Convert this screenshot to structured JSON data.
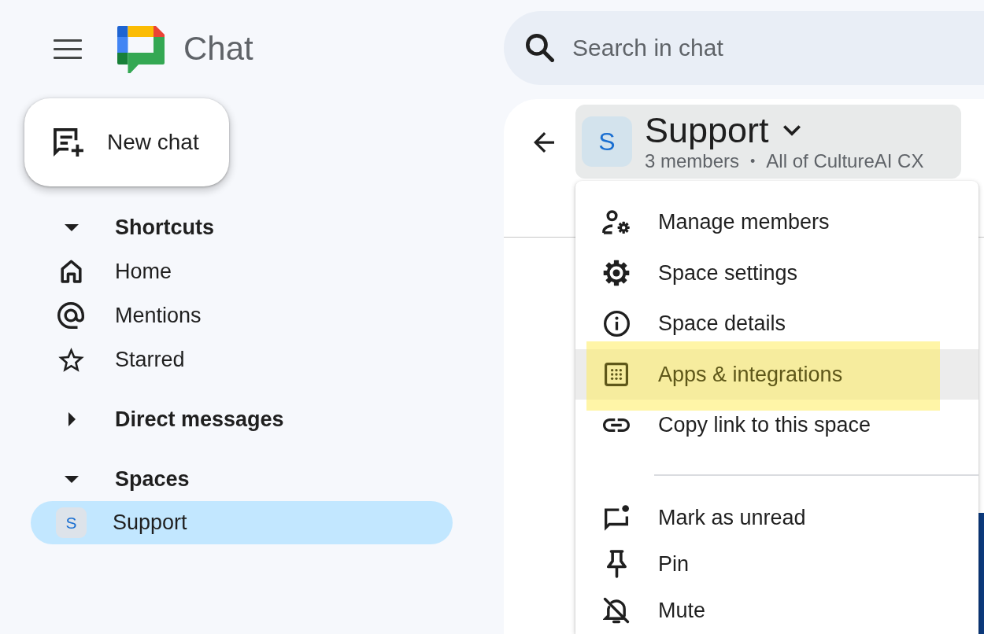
{
  "app": {
    "title": "Chat"
  },
  "search": {
    "placeholder": "Search in chat"
  },
  "new_chat": {
    "label": "New chat"
  },
  "sidebar": {
    "sections": [
      {
        "title": "Shortcuts",
        "expanded": true,
        "items": [
          {
            "kind": "shortcut",
            "label": "Home",
            "selected": false
          },
          {
            "kind": "shortcut",
            "label": "Mentions",
            "selected": false
          },
          {
            "kind": "shortcut",
            "label": "Starred",
            "selected": false
          }
        ]
      },
      {
        "title": "Direct messages",
        "expanded": false
      },
      {
        "title": "Spaces",
        "expanded": true,
        "items": [
          {
            "kind": "space",
            "avatar": "S",
            "label": "Support",
            "selected": true
          }
        ]
      }
    ]
  },
  "space_header": {
    "avatar": "S",
    "name": "Support",
    "members": "3 members",
    "separator": "•",
    "audience": "All of CultureAI CX"
  },
  "menu": {
    "sections": [
      {
        "items": [
          {
            "label": "Manage members",
            "hovered": false,
            "highlighted": false
          },
          {
            "label": "Space settings",
            "hovered": false,
            "highlighted": false
          },
          {
            "label": "Space details",
            "hovered": false,
            "highlighted": false
          },
          {
            "label": "Apps & integrations",
            "hovered": true,
            "highlighted": true
          },
          {
            "label": "Copy link to this space",
            "hovered": false,
            "highlighted": false
          }
        ]
      },
      {
        "items": [
          {
            "label": "Mark as unread",
            "hovered": false,
            "highlighted": false
          },
          {
            "label": "Pin",
            "hovered": false,
            "highlighted": false
          },
          {
            "label": "Mute",
            "hovered": false,
            "highlighted": false
          }
        ]
      }
    ]
  }
}
